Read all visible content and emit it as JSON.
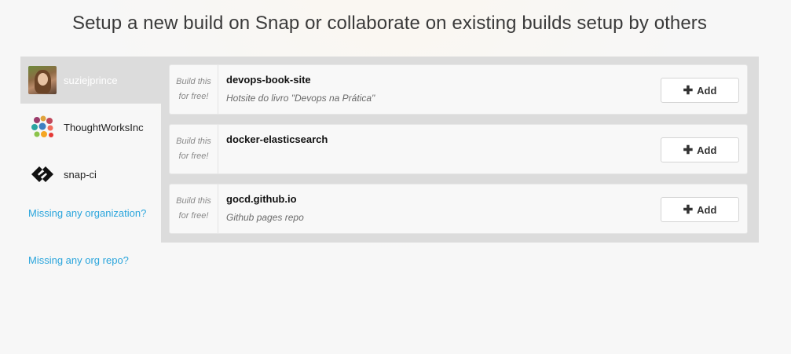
{
  "header": {
    "title": "Setup a new build on Snap or collaborate on existing builds setup by others"
  },
  "sidebar": {
    "orgs": [
      {
        "label": "suziejprince",
        "icon": "user-avatar-icon",
        "active": true
      },
      {
        "label": "ThoughtWorksInc",
        "icon": "thoughtworks-logo-icon",
        "active": false
      },
      {
        "label": "snap-ci",
        "icon": "snap-ci-logo-icon",
        "active": false
      }
    ],
    "links": {
      "missing_org": "Missing any organization?",
      "missing_repo": "Missing any org repo?"
    }
  },
  "repos": [
    {
      "free_tag": "Build this for free!",
      "name": "devops-book-site",
      "description": "Hotsite do livro \"Devops na Prática\"",
      "add_label": "Add"
    },
    {
      "free_tag": "Build this for free!",
      "name": "docker-elasticsearch",
      "description": "",
      "add_label": "Add"
    },
    {
      "free_tag": "Build this for free!",
      "name": "gocd.github.io",
      "description": "Github pages repo",
      "add_label": "Add"
    }
  ],
  "colors": {
    "link": "#2aa5dc",
    "panel_bg": "#dcdcdc",
    "active_org_text": "#ffffff"
  }
}
